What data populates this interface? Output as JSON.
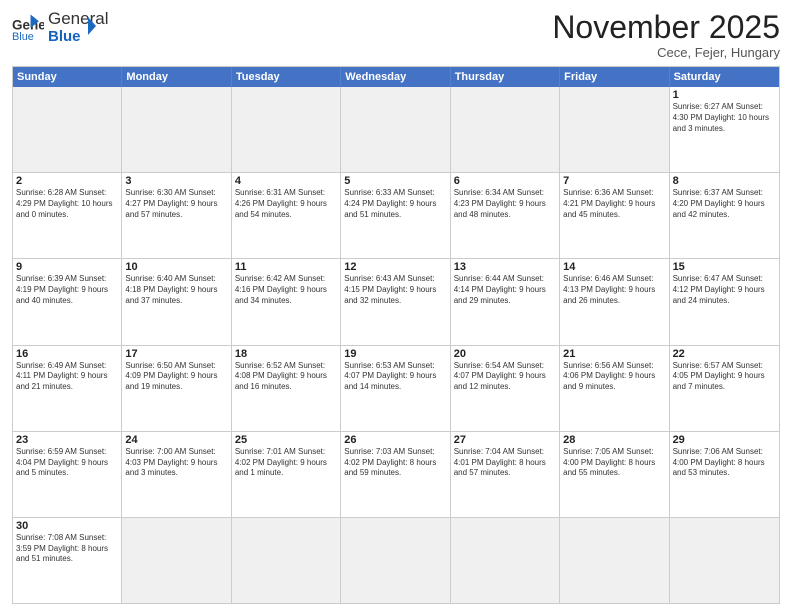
{
  "header": {
    "logo_general": "General",
    "logo_blue": "Blue",
    "month_title": "November 2025",
    "location": "Cece, Fejer, Hungary"
  },
  "weekdays": [
    "Sunday",
    "Monday",
    "Tuesday",
    "Wednesday",
    "Thursday",
    "Friday",
    "Saturday"
  ],
  "rows": [
    [
      {
        "day": "",
        "info": "",
        "empty": true
      },
      {
        "day": "",
        "info": "",
        "empty": true
      },
      {
        "day": "",
        "info": "",
        "empty": true
      },
      {
        "day": "",
        "info": "",
        "empty": true
      },
      {
        "day": "",
        "info": "",
        "empty": true
      },
      {
        "day": "",
        "info": "",
        "empty": true
      },
      {
        "day": "1",
        "info": "Sunrise: 6:27 AM\nSunset: 4:30 PM\nDaylight: 10 hours\nand 3 minutes.",
        "empty": false
      }
    ],
    [
      {
        "day": "2",
        "info": "Sunrise: 6:28 AM\nSunset: 4:29 PM\nDaylight: 10 hours\nand 0 minutes.",
        "empty": false
      },
      {
        "day": "3",
        "info": "Sunrise: 6:30 AM\nSunset: 4:27 PM\nDaylight: 9 hours\nand 57 minutes.",
        "empty": false
      },
      {
        "day": "4",
        "info": "Sunrise: 6:31 AM\nSunset: 4:26 PM\nDaylight: 9 hours\nand 54 minutes.",
        "empty": false
      },
      {
        "day": "5",
        "info": "Sunrise: 6:33 AM\nSunset: 4:24 PM\nDaylight: 9 hours\nand 51 minutes.",
        "empty": false
      },
      {
        "day": "6",
        "info": "Sunrise: 6:34 AM\nSunset: 4:23 PM\nDaylight: 9 hours\nand 48 minutes.",
        "empty": false
      },
      {
        "day": "7",
        "info": "Sunrise: 6:36 AM\nSunset: 4:21 PM\nDaylight: 9 hours\nand 45 minutes.",
        "empty": false
      },
      {
        "day": "8",
        "info": "Sunrise: 6:37 AM\nSunset: 4:20 PM\nDaylight: 9 hours\nand 42 minutes.",
        "empty": false
      }
    ],
    [
      {
        "day": "9",
        "info": "Sunrise: 6:39 AM\nSunset: 4:19 PM\nDaylight: 9 hours\nand 40 minutes.",
        "empty": false
      },
      {
        "day": "10",
        "info": "Sunrise: 6:40 AM\nSunset: 4:18 PM\nDaylight: 9 hours\nand 37 minutes.",
        "empty": false
      },
      {
        "day": "11",
        "info": "Sunrise: 6:42 AM\nSunset: 4:16 PM\nDaylight: 9 hours\nand 34 minutes.",
        "empty": false
      },
      {
        "day": "12",
        "info": "Sunrise: 6:43 AM\nSunset: 4:15 PM\nDaylight: 9 hours\nand 32 minutes.",
        "empty": false
      },
      {
        "day": "13",
        "info": "Sunrise: 6:44 AM\nSunset: 4:14 PM\nDaylight: 9 hours\nand 29 minutes.",
        "empty": false
      },
      {
        "day": "14",
        "info": "Sunrise: 6:46 AM\nSunset: 4:13 PM\nDaylight: 9 hours\nand 26 minutes.",
        "empty": false
      },
      {
        "day": "15",
        "info": "Sunrise: 6:47 AM\nSunset: 4:12 PM\nDaylight: 9 hours\nand 24 minutes.",
        "empty": false
      }
    ],
    [
      {
        "day": "16",
        "info": "Sunrise: 6:49 AM\nSunset: 4:11 PM\nDaylight: 9 hours\nand 21 minutes.",
        "empty": false
      },
      {
        "day": "17",
        "info": "Sunrise: 6:50 AM\nSunset: 4:09 PM\nDaylight: 9 hours\nand 19 minutes.",
        "empty": false
      },
      {
        "day": "18",
        "info": "Sunrise: 6:52 AM\nSunset: 4:08 PM\nDaylight: 9 hours\nand 16 minutes.",
        "empty": false
      },
      {
        "day": "19",
        "info": "Sunrise: 6:53 AM\nSunset: 4:07 PM\nDaylight: 9 hours\nand 14 minutes.",
        "empty": false
      },
      {
        "day": "20",
        "info": "Sunrise: 6:54 AM\nSunset: 4:07 PM\nDaylight: 9 hours\nand 12 minutes.",
        "empty": false
      },
      {
        "day": "21",
        "info": "Sunrise: 6:56 AM\nSunset: 4:06 PM\nDaylight: 9 hours\nand 9 minutes.",
        "empty": false
      },
      {
        "day": "22",
        "info": "Sunrise: 6:57 AM\nSunset: 4:05 PM\nDaylight: 9 hours\nand 7 minutes.",
        "empty": false
      }
    ],
    [
      {
        "day": "23",
        "info": "Sunrise: 6:59 AM\nSunset: 4:04 PM\nDaylight: 9 hours\nand 5 minutes.",
        "empty": false
      },
      {
        "day": "24",
        "info": "Sunrise: 7:00 AM\nSunset: 4:03 PM\nDaylight: 9 hours\nand 3 minutes.",
        "empty": false
      },
      {
        "day": "25",
        "info": "Sunrise: 7:01 AM\nSunset: 4:02 PM\nDaylight: 9 hours\nand 1 minute.",
        "empty": false
      },
      {
        "day": "26",
        "info": "Sunrise: 7:03 AM\nSunset: 4:02 PM\nDaylight: 8 hours\nand 59 minutes.",
        "empty": false
      },
      {
        "day": "27",
        "info": "Sunrise: 7:04 AM\nSunset: 4:01 PM\nDaylight: 8 hours\nand 57 minutes.",
        "empty": false
      },
      {
        "day": "28",
        "info": "Sunrise: 7:05 AM\nSunset: 4:00 PM\nDaylight: 8 hours\nand 55 minutes.",
        "empty": false
      },
      {
        "day": "29",
        "info": "Sunrise: 7:06 AM\nSunset: 4:00 PM\nDaylight: 8 hours\nand 53 minutes.",
        "empty": false
      }
    ],
    [
      {
        "day": "30",
        "info": "Sunrise: 7:08 AM\nSunset: 3:59 PM\nDaylight: 8 hours\nand 51 minutes.",
        "empty": false
      },
      {
        "day": "",
        "info": "",
        "empty": true
      },
      {
        "day": "",
        "info": "",
        "empty": true
      },
      {
        "day": "",
        "info": "",
        "empty": true
      },
      {
        "day": "",
        "info": "",
        "empty": true
      },
      {
        "day": "",
        "info": "",
        "empty": true
      },
      {
        "day": "",
        "info": "",
        "empty": true
      }
    ]
  ]
}
